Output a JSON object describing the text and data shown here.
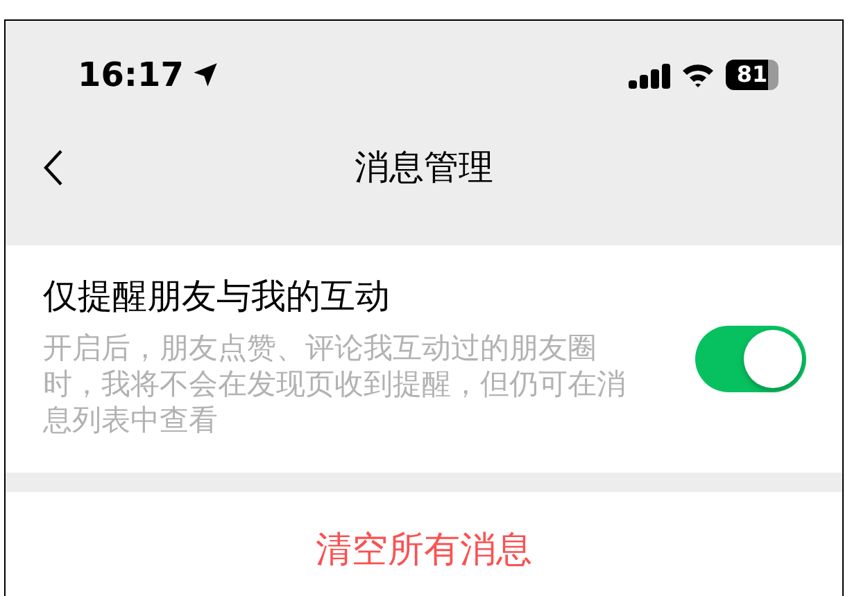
{
  "status_bar": {
    "time": "16:17",
    "battery": "81"
  },
  "nav": {
    "title": "消息管理"
  },
  "settings": [
    {
      "kind": "toggle",
      "title": "仅提醒朋友与我的互动",
      "description": "开启后，朋友点赞、评论我互动过的朋友圈时，我将不会在发现页收到提醒，但仍可在消息列表中查看",
      "on": true
    }
  ],
  "actions": [
    {
      "label": "清空所有消息"
    }
  ]
}
